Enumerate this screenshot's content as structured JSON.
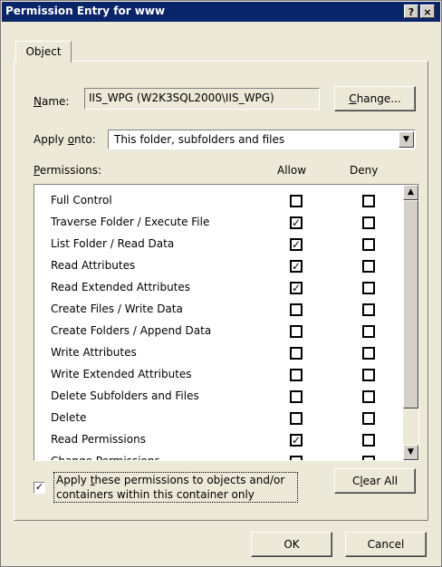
{
  "window": {
    "title": "Permission Entry for www",
    "help_label": "?",
    "close_label": "×"
  },
  "tabs": [
    {
      "label": "Object"
    }
  ],
  "name_row": {
    "label_mnemonic": "N",
    "label_rest": "ame:",
    "value": "IIS_WPG (W2K3SQL2000\\IIS_WPG)",
    "change_label_mnemonic": "C",
    "change_label_rest": "hange..."
  },
  "apply_onto": {
    "label_pre": "Apply ",
    "label_mnemonic": "o",
    "label_rest": "nto:",
    "value": "This folder, subfolders and files"
  },
  "permissions": {
    "header_mnemonic": "P",
    "header_rest": "ermissions:",
    "allow_header": "Allow",
    "deny_header": "Deny",
    "rows": [
      {
        "name": "Full Control",
        "allow": false,
        "deny": false
      },
      {
        "name": "Traverse Folder / Execute File",
        "allow": true,
        "deny": false
      },
      {
        "name": "List Folder / Read Data",
        "allow": true,
        "deny": false
      },
      {
        "name": "Read Attributes",
        "allow": true,
        "deny": false
      },
      {
        "name": "Read Extended Attributes",
        "allow": true,
        "deny": false
      },
      {
        "name": "Create Files / Write Data",
        "allow": false,
        "deny": false
      },
      {
        "name": "Create Folders / Append Data",
        "allow": false,
        "deny": false
      },
      {
        "name": "Write Attributes",
        "allow": false,
        "deny": false
      },
      {
        "name": "Write Extended Attributes",
        "allow": false,
        "deny": false
      },
      {
        "name": "Delete Subfolders and Files",
        "allow": false,
        "deny": false
      },
      {
        "name": "Delete",
        "allow": false,
        "deny": false
      },
      {
        "name": "Read Permissions",
        "allow": true,
        "deny": false
      },
      {
        "name": "Change Permissions",
        "allow": false,
        "deny": false
      }
    ]
  },
  "apply_checkbox": {
    "checked": true,
    "line1_pre": "Apply ",
    "line1_mnemonic": "t",
    "line1_rest": "hese permissions to objects and/or",
    "line2": "containers within this container only"
  },
  "clear_all": {
    "pre": "C",
    "mnemonic": "l",
    "rest": "ear All"
  },
  "footer": {
    "ok_label": "OK",
    "cancel_label": "Cancel"
  },
  "check_glyph": "✓"
}
